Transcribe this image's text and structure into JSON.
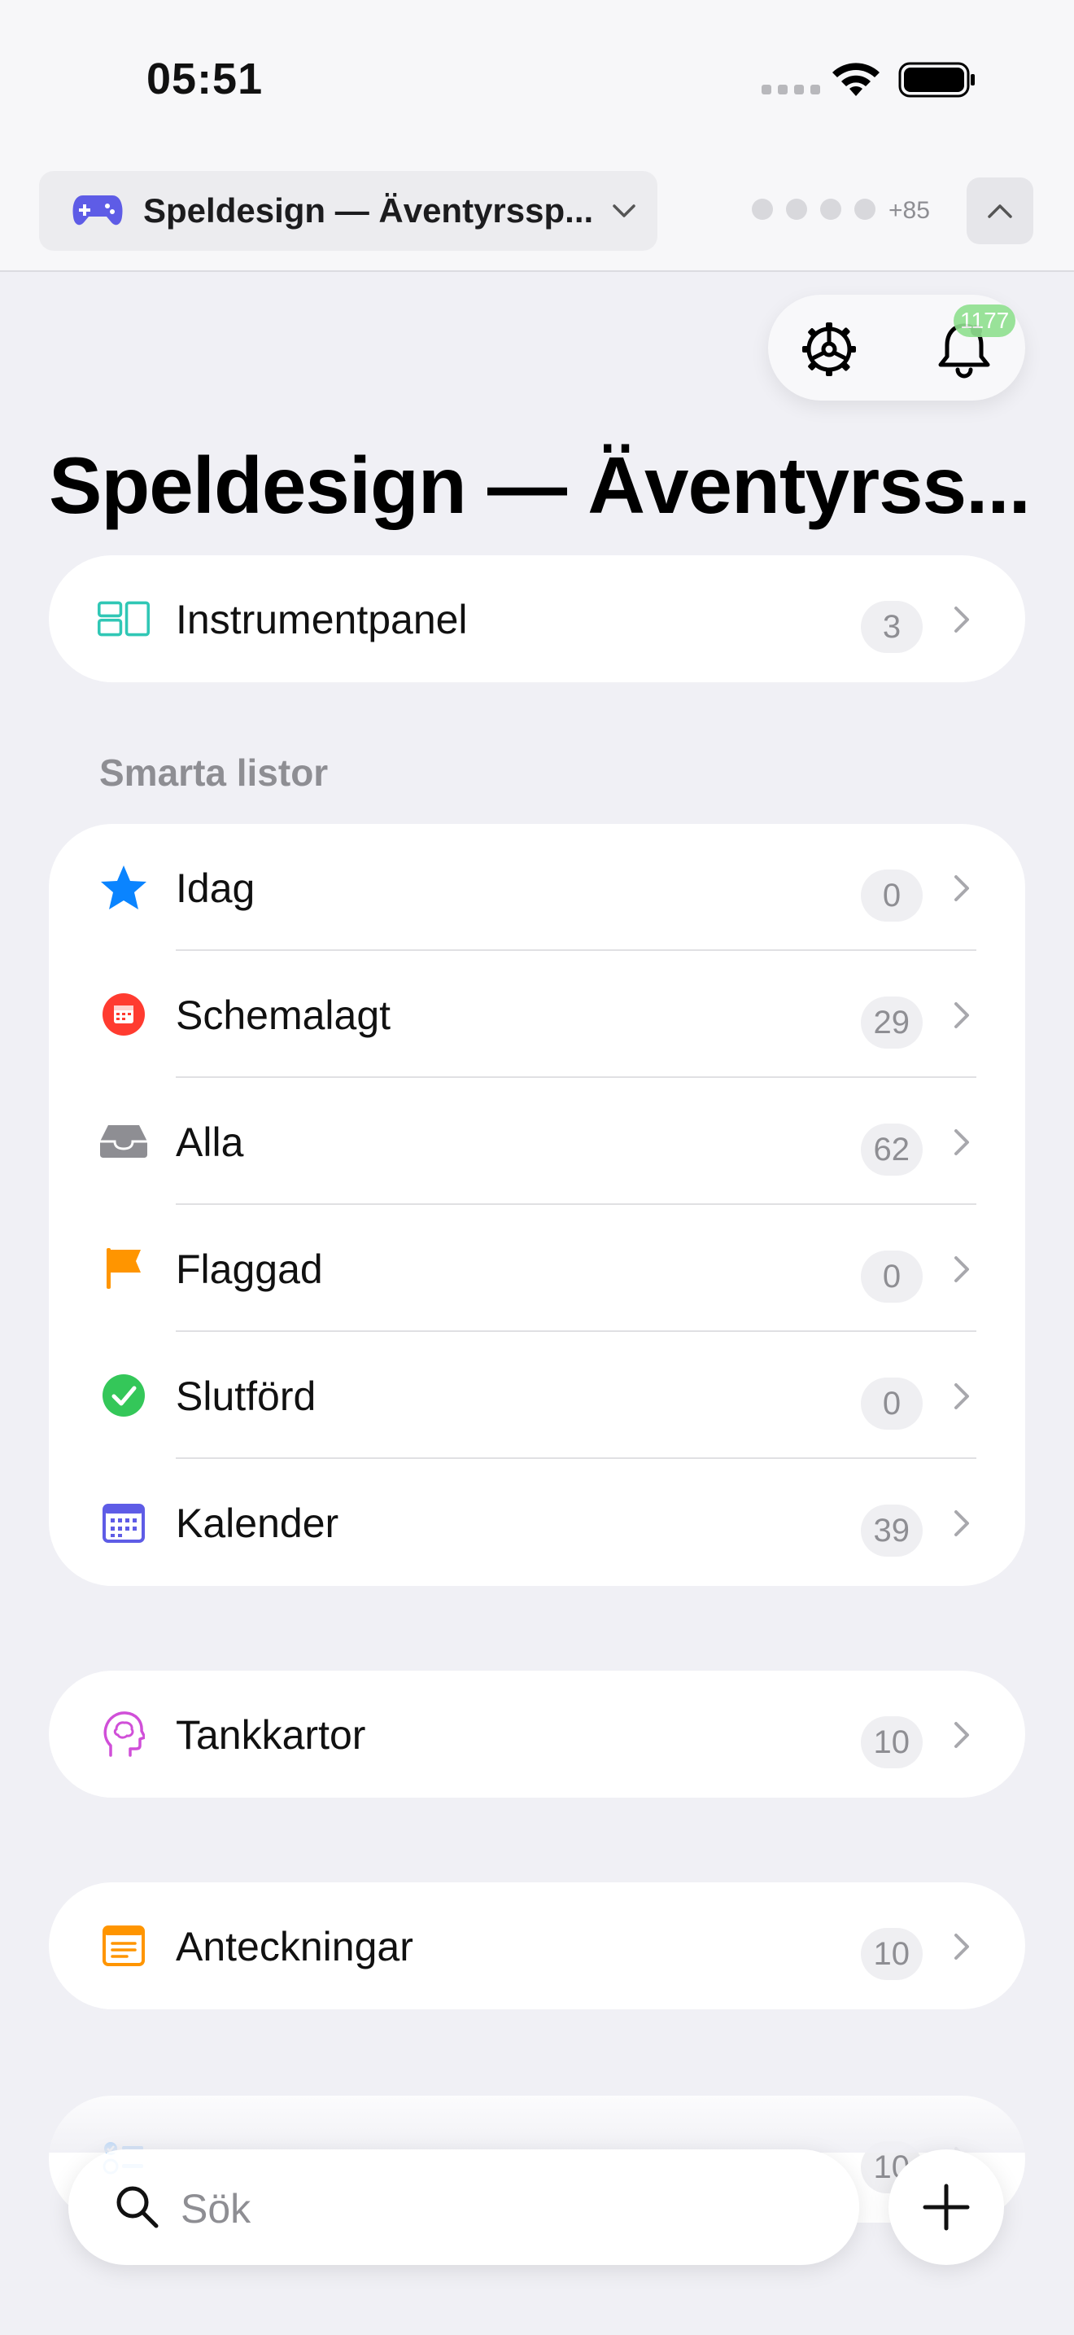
{
  "status": {
    "time": "05:51"
  },
  "context": {
    "workspace_name": "Speldesign — Äventyrssp...",
    "member_extra": "+85"
  },
  "header": {
    "notification_count": "1177"
  },
  "page": {
    "title": "Speldesign — Äventyrss..."
  },
  "dashboard": {
    "label": "Instrumentpanel",
    "count": "3"
  },
  "smart_lists": {
    "section_label": "Smarta listor",
    "items": [
      {
        "label": "Idag",
        "count": "0",
        "icon": "star-icon"
      },
      {
        "label": "Schemalagt",
        "count": "29",
        "icon": "calendar-red-icon"
      },
      {
        "label": "Alla",
        "count": "62",
        "icon": "inbox-icon"
      },
      {
        "label": "Flaggad",
        "count": "0",
        "icon": "flag-icon"
      },
      {
        "label": "Slutförd",
        "count": "0",
        "icon": "checkmark-icon"
      },
      {
        "label": "Kalender",
        "count": "39",
        "icon": "calendar-grid-icon"
      }
    ]
  },
  "mindmaps": {
    "label": "Tankkartor",
    "count": "10"
  },
  "notes": {
    "label": "Anteckningar",
    "count": "10"
  },
  "tasklists": {
    "count": "10"
  },
  "search": {
    "placeholder": "Sök"
  },
  "colors": {
    "accent": "#0a84ff",
    "red": "#ff3b30",
    "orange": "#ff9500",
    "green": "#34c759",
    "purple": "#5e5ce6",
    "teal": "#30c7b5"
  }
}
